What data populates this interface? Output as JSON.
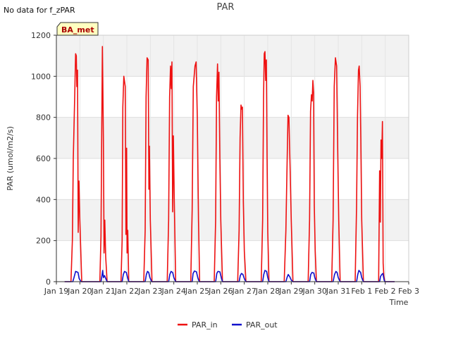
{
  "message": "No data for f_zPAR",
  "chart_data": {
    "type": "line",
    "title": "PAR",
    "xlabel": "Time",
    "ylabel": "PAR (umol/m2/s)",
    "ylim": [
      0,
      1200
    ],
    "xlim": [
      0,
      15
    ],
    "yticks": [
      0,
      200,
      400,
      600,
      800,
      1000,
      1200
    ],
    "xticks": [
      {
        "value": 0,
        "label": "Jan 19"
      },
      {
        "value": 1,
        "label": "Jan 20"
      },
      {
        "value": 2,
        "label": "Jan 21"
      },
      {
        "value": 3,
        "label": "Jan 22"
      },
      {
        "value": 4,
        "label": "Jan 23"
      },
      {
        "value": 5,
        "label": "Jan 24"
      },
      {
        "value": 6,
        "label": "Jan 25"
      },
      {
        "value": 7,
        "label": "Jan 26"
      },
      {
        "value": 8,
        "label": "Jan 27"
      },
      {
        "value": 9,
        "label": "Jan 28"
      },
      {
        "value": 10,
        "label": "Jan 29"
      },
      {
        "value": 11,
        "label": "Jan 30"
      },
      {
        "value": 12,
        "label": "Jan 31"
      },
      {
        "value": 13,
        "label": "Feb 1"
      },
      {
        "value": 14,
        "label": "Feb 2"
      },
      {
        "value": 15,
        "label": "Feb 3"
      }
    ],
    "grid": true,
    "legend_position": "bottom-center",
    "site_label": "BA_met",
    "series": [
      {
        "name": "PAR_in",
        "color": "#ee1111",
        "points": [
          [
            0.35,
            0
          ],
          [
            0.62,
            0
          ],
          [
            0.68,
            200
          ],
          [
            0.72,
            600
          ],
          [
            0.78,
            900
          ],
          [
            0.82,
            1110
          ],
          [
            0.85,
            1100
          ],
          [
            0.87,
            950
          ],
          [
            0.9,
            1030
          ],
          [
            0.93,
            240
          ],
          [
            0.96,
            490
          ],
          [
            1.0,
            300
          ],
          [
            1.08,
            0
          ],
          [
            1.05,
            0
          ],
          [
            1.85,
            0
          ],
          [
            1.9,
            220
          ],
          [
            1.93,
            700
          ],
          [
            1.96,
            1145
          ],
          [
            2.0,
            700
          ],
          [
            2.03,
            140
          ],
          [
            2.06,
            300
          ],
          [
            2.1,
            120
          ],
          [
            2.16,
            0
          ],
          [
            2.75,
            0
          ],
          [
            2.8,
            200
          ],
          [
            2.83,
            850
          ],
          [
            2.87,
            1000
          ],
          [
            2.93,
            950
          ],
          [
            2.96,
            230
          ],
          [
            2.99,
            650
          ],
          [
            3.01,
            140
          ],
          [
            3.04,
            250
          ],
          [
            3.08,
            0
          ],
          [
            3.72,
            0
          ],
          [
            3.78,
            250
          ],
          [
            3.82,
            900
          ],
          [
            3.86,
            1090
          ],
          [
            3.91,
            1080
          ],
          [
            3.94,
            450
          ],
          [
            3.96,
            660
          ],
          [
            4.0,
            300
          ],
          [
            4.07,
            0
          ],
          [
            4.72,
            0
          ],
          [
            4.78,
            300
          ],
          [
            4.82,
            900
          ],
          [
            4.86,
            1050
          ],
          [
            4.89,
            940
          ],
          [
            4.92,
            1070
          ],
          [
            4.95,
            340
          ],
          [
            4.98,
            710
          ],
          [
            5.02,
            400
          ],
          [
            5.08,
            0
          ],
          [
            5.72,
            0
          ],
          [
            5.78,
            350
          ],
          [
            5.83,
            950
          ],
          [
            5.9,
            1050
          ],
          [
            5.95,
            1070
          ],
          [
            6.0,
            800
          ],
          [
            6.05,
            300
          ],
          [
            6.1,
            0
          ],
          [
            6.72,
            0
          ],
          [
            6.78,
            300
          ],
          [
            6.82,
            900
          ],
          [
            6.86,
            1060
          ],
          [
            6.89,
            880
          ],
          [
            6.92,
            1020
          ],
          [
            6.96,
            600
          ],
          [
            7.0,
            300
          ],
          [
            7.07,
            0
          ],
          [
            7.72,
            0
          ],
          [
            7.78,
            250
          ],
          [
            7.82,
            700
          ],
          [
            7.86,
            860
          ],
          [
            7.89,
            840
          ],
          [
            7.92,
            850
          ],
          [
            7.96,
            390
          ],
          [
            8.0,
            150
          ],
          [
            8.07,
            0
          ],
          [
            8.72,
            0
          ],
          [
            8.78,
            300
          ],
          [
            8.82,
            900
          ],
          [
            8.85,
            1110
          ],
          [
            8.88,
            1120
          ],
          [
            8.91,
            980
          ],
          [
            8.94,
            1080
          ],
          [
            8.97,
            600
          ],
          [
            9.0,
            240
          ],
          [
            9.05,
            0
          ],
          [
            9.7,
            0
          ],
          [
            9.77,
            250
          ],
          [
            9.81,
            500
          ],
          [
            9.86,
            810
          ],
          [
            9.9,
            800
          ],
          [
            9.95,
            550
          ],
          [
            10.0,
            300
          ],
          [
            10.07,
            0
          ],
          [
            10.72,
            0
          ],
          [
            10.78,
            300
          ],
          [
            10.82,
            830
          ],
          [
            10.86,
            910
          ],
          [
            10.89,
            880
          ],
          [
            10.92,
            980
          ],
          [
            10.95,
            920
          ],
          [
            10.98,
            370
          ],
          [
            11.02,
            150
          ],
          [
            11.07,
            0
          ],
          [
            11.72,
            0
          ],
          [
            11.78,
            300
          ],
          [
            11.83,
            950
          ],
          [
            11.88,
            1090
          ],
          [
            11.93,
            1050
          ],
          [
            11.97,
            700
          ],
          [
            12.02,
            300
          ],
          [
            12.08,
            0
          ],
          [
            12.72,
            0
          ],
          [
            12.78,
            370
          ],
          [
            12.82,
            800
          ],
          [
            12.86,
            1030
          ],
          [
            12.89,
            1050
          ],
          [
            12.93,
            950
          ],
          [
            12.96,
            700
          ],
          [
            13.0,
            300
          ],
          [
            13.07,
            0
          ],
          [
            13.72,
            0
          ],
          [
            13.76,
            540
          ],
          [
            13.79,
            290
          ],
          [
            13.82,
            690
          ],
          [
            13.85,
            600
          ],
          [
            13.88,
            780
          ],
          [
            13.91,
            90
          ],
          [
            13.94,
            30
          ],
          [
            13.98,
            0
          ],
          [
            14.4,
            0
          ]
        ]
      },
      {
        "name": "PAR_out",
        "color": "#1111cc",
        "points": [
          [
            0.35,
            0
          ],
          [
            0.7,
            0
          ],
          [
            0.75,
            20
          ],
          [
            0.82,
            50
          ],
          [
            0.92,
            45
          ],
          [
            0.97,
            15
          ],
          [
            1.05,
            0
          ],
          [
            1.9,
            0
          ],
          [
            1.94,
            30
          ],
          [
            1.97,
            55
          ],
          [
            2.0,
            20
          ],
          [
            2.05,
            30
          ],
          [
            2.1,
            15
          ],
          [
            2.16,
            0
          ],
          [
            2.8,
            0
          ],
          [
            2.85,
            35
          ],
          [
            2.9,
            50
          ],
          [
            2.98,
            45
          ],
          [
            3.03,
            20
          ],
          [
            3.08,
            0
          ],
          [
            3.78,
            0
          ],
          [
            3.83,
            35
          ],
          [
            3.88,
            50
          ],
          [
            3.93,
            45
          ],
          [
            3.98,
            20
          ],
          [
            4.06,
            0
          ],
          [
            4.78,
            0
          ],
          [
            4.83,
            35
          ],
          [
            4.88,
            50
          ],
          [
            4.95,
            45
          ],
          [
            5.0,
            20
          ],
          [
            5.08,
            0
          ],
          [
            5.78,
            0
          ],
          [
            5.82,
            40
          ],
          [
            5.88,
            52
          ],
          [
            5.96,
            48
          ],
          [
            6.02,
            20
          ],
          [
            6.08,
            0
          ],
          [
            6.78,
            0
          ],
          [
            6.83,
            40
          ],
          [
            6.88,
            50
          ],
          [
            6.96,
            48
          ],
          [
            7.02,
            20
          ],
          [
            7.07,
            0
          ],
          [
            7.78,
            0
          ],
          [
            7.83,
            30
          ],
          [
            7.88,
            40
          ],
          [
            7.94,
            35
          ],
          [
            8.0,
            15
          ],
          [
            8.07,
            0
          ],
          [
            8.78,
            0
          ],
          [
            8.83,
            35
          ],
          [
            8.88,
            55
          ],
          [
            8.95,
            50
          ],
          [
            9.0,
            20
          ],
          [
            9.05,
            0
          ],
          [
            9.77,
            0
          ],
          [
            9.82,
            20
          ],
          [
            9.87,
            35
          ],
          [
            9.93,
            25
          ],
          [
            10.0,
            8
          ],
          [
            10.07,
            0
          ],
          [
            10.78,
            0
          ],
          [
            10.83,
            35
          ],
          [
            10.88,
            45
          ],
          [
            10.96,
            42
          ],
          [
            11.0,
            20
          ],
          [
            11.07,
            0
          ],
          [
            11.78,
            0
          ],
          [
            11.84,
            35
          ],
          [
            11.9,
            50
          ],
          [
            11.95,
            45
          ],
          [
            12.0,
            20
          ],
          [
            12.08,
            0
          ],
          [
            12.78,
            0
          ],
          [
            12.83,
            35
          ],
          [
            12.88,
            55
          ],
          [
            12.95,
            45
          ],
          [
            13.0,
            20
          ],
          [
            13.07,
            0
          ],
          [
            13.76,
            0
          ],
          [
            13.8,
            25
          ],
          [
            13.85,
            35
          ],
          [
            13.9,
            40
          ],
          [
            13.95,
            10
          ],
          [
            13.98,
            0
          ],
          [
            14.4,
            0
          ]
        ]
      }
    ]
  }
}
